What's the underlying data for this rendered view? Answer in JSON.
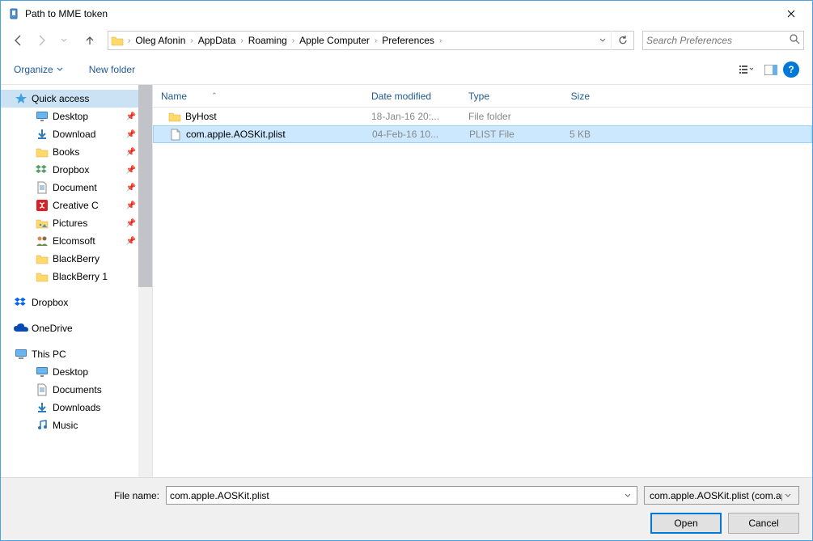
{
  "window": {
    "title": "Path to MME token"
  },
  "breadcrumb": {
    "items": [
      "Oleg Afonin",
      "AppData",
      "Roaming",
      "Apple Computer",
      "Preferences"
    ]
  },
  "search": {
    "placeholder": "Search Preferences"
  },
  "toolbar": {
    "organize": "Organize",
    "newfolder": "New folder"
  },
  "sidebar": {
    "sections": [
      {
        "name": "Quick access",
        "icon": "star",
        "selected": true,
        "items": [
          {
            "label": "Desktop",
            "icon": "desktop",
            "pinned": true
          },
          {
            "label": "Download",
            "icon": "download",
            "pinned": true
          },
          {
            "label": "Books",
            "icon": "folder",
            "pinned": true
          },
          {
            "label": "Dropbox",
            "icon": "dropbox",
            "pinned": true
          },
          {
            "label": "Document",
            "icon": "document",
            "pinned": true
          },
          {
            "label": "Creative C",
            "icon": "creative",
            "pinned": true
          },
          {
            "label": "Pictures",
            "icon": "pictures",
            "pinned": true
          },
          {
            "label": "Elcomsoft",
            "icon": "people",
            "pinned": true
          },
          {
            "label": "BlackBerry",
            "icon": "folder",
            "pinned": false
          },
          {
            "label": "BlackBerry 1",
            "icon": "folder",
            "pinned": false
          }
        ]
      },
      {
        "name": "Dropbox",
        "icon": "dropbox-main",
        "items": []
      },
      {
        "name": "OneDrive",
        "icon": "onedrive",
        "items": []
      },
      {
        "name": "This PC",
        "icon": "pc",
        "items": [
          {
            "label": "Desktop",
            "icon": "desktop"
          },
          {
            "label": "Documents",
            "icon": "document"
          },
          {
            "label": "Downloads",
            "icon": "download"
          },
          {
            "label": "Music",
            "icon": "music"
          }
        ]
      }
    ]
  },
  "columns": {
    "name": "Name",
    "date": "Date modified",
    "type": "Type",
    "size": "Size"
  },
  "files": [
    {
      "name": "ByHost",
      "date": "18-Jan-16 20:...",
      "type": "File folder",
      "size": "",
      "icon": "folder",
      "selected": false
    },
    {
      "name": "com.apple.AOSKit.plist",
      "date": "04-Feb-16 10...",
      "type": "PLIST File",
      "size": "5 KB",
      "icon": "file",
      "selected": true
    }
  ],
  "footer": {
    "filename_label": "File name:",
    "filename_value": "com.apple.AOSKit.plist",
    "filetype": "com.apple.AOSKit.plist (com.ap",
    "open": "Open",
    "cancel": "Cancel"
  }
}
